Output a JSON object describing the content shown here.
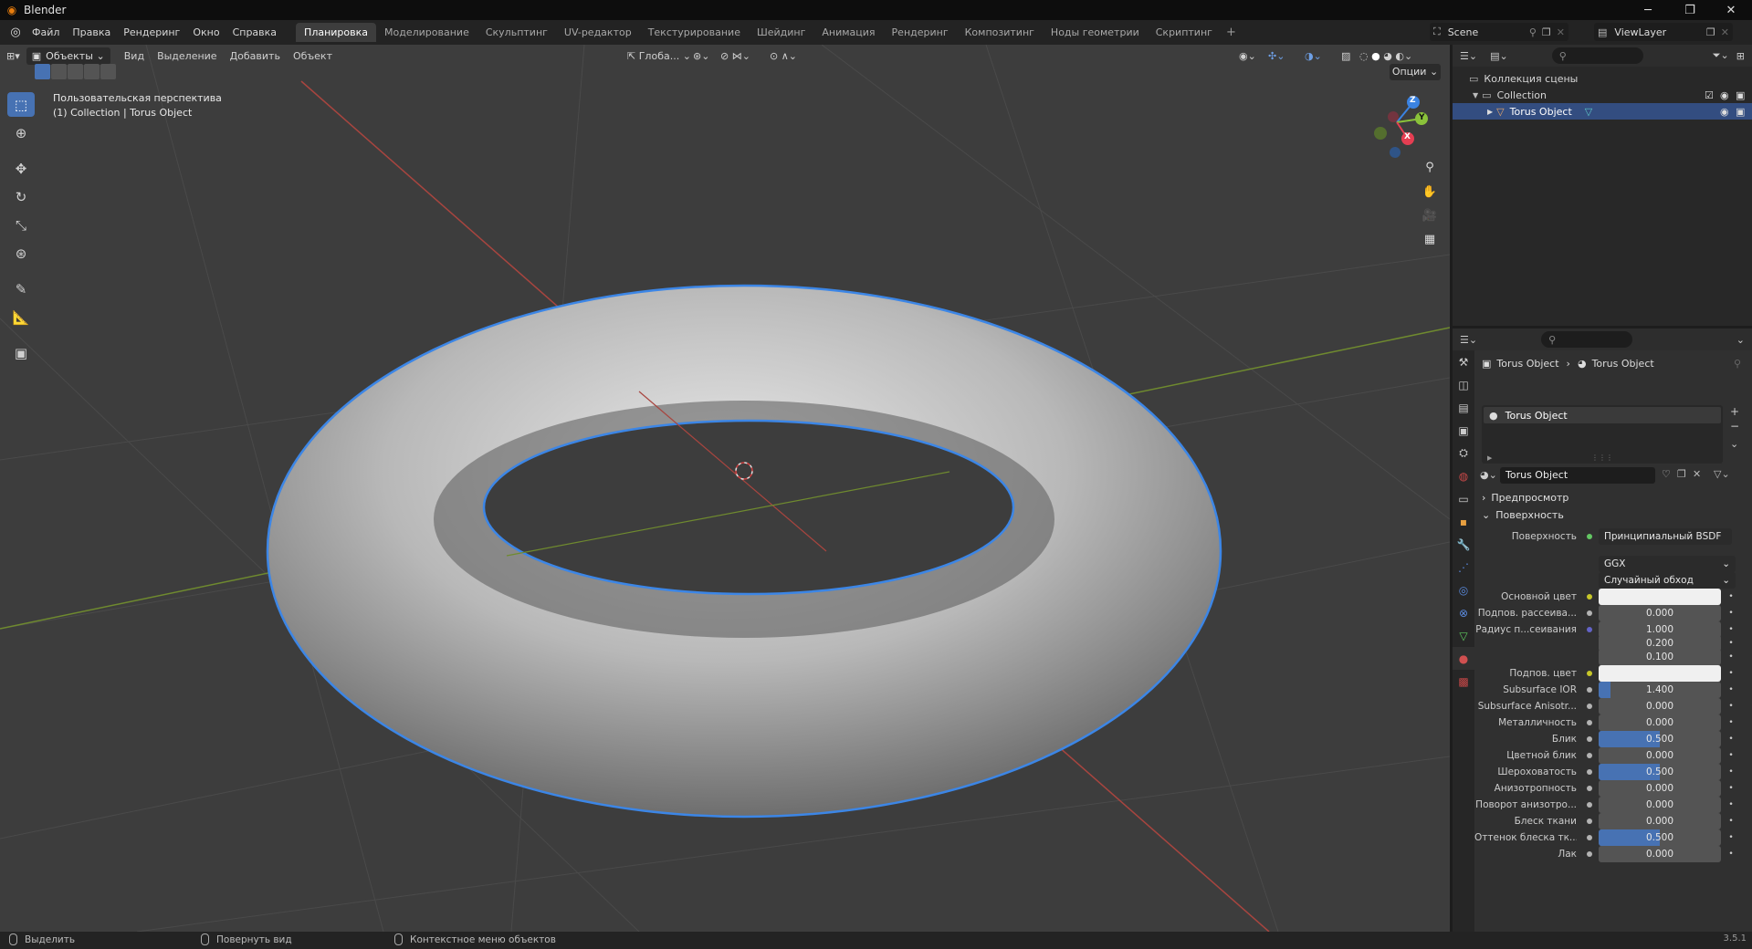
{
  "window": {
    "title": "Blender",
    "minimize_icon": "minimize-icon",
    "maximize_icon": "restore-icon",
    "close_icon": "close-icon"
  },
  "menu": [
    "Файл",
    "Правка",
    "Рендеринг",
    "Окно",
    "Справка"
  ],
  "workspaces": [
    {
      "label": "Планировка",
      "active": true
    },
    {
      "label": "Моделирование"
    },
    {
      "label": "Скульптинг"
    },
    {
      "label": "UV-редактор"
    },
    {
      "label": "Текстурирование"
    },
    {
      "label": "Шейдинг"
    },
    {
      "label": "Анимация"
    },
    {
      "label": "Рендеринг"
    },
    {
      "label": "Композитинг"
    },
    {
      "label": "Ноды геометрии"
    },
    {
      "label": "Скриптинг"
    }
  ],
  "workspace_add": "+",
  "scene": {
    "name": "Scene"
  },
  "view_layer": {
    "name": "ViewLayer"
  },
  "viewport": {
    "mode": "Объекты",
    "menus": [
      "Вид",
      "Выделение",
      "Добавить",
      "Объект"
    ],
    "orientation": "Глоба...",
    "options_label": "Опции",
    "overlay_line1": "Пользовательская перспектива",
    "overlay_line2": "(1) Collection | Torus Object",
    "gizmo_axes": {
      "x": "X",
      "y": "Y",
      "z": "Z"
    },
    "colors": {
      "grid_bg": "#3d3d3d",
      "x_axis": "#c8403e",
      "y_axis": "#7c9a2e",
      "selection": "#3c86e6"
    }
  },
  "outliner": {
    "root": "Коллекция сцены",
    "collection": "Collection",
    "object": "Torus Object"
  },
  "properties": {
    "breadcrumb_object": "Torus Object",
    "breadcrumb_material": "Torus Object",
    "slot_name": "Torus Object",
    "material_name": "Torus Object",
    "panel_preview": "Предпросмотр",
    "panel_surface": "Поверхность",
    "surface_label": "Поверхность",
    "surface_shader": "Принципиальный BSDF",
    "distribution": "GGX",
    "subsurface_method": "Случайный обход",
    "rows": [
      {
        "label": "Основной цвет",
        "type": "color",
        "dot": "yellow"
      },
      {
        "label": "Подпов. рассеива...",
        "value": "0.000",
        "dot": "gray"
      },
      {
        "label": "Радиус п...сеивания",
        "value": "1.000",
        "dot": "blue"
      },
      {
        "label": "",
        "value": "0.200",
        "dot": "none"
      },
      {
        "label": "",
        "value": "0.100",
        "dot": "none"
      },
      {
        "label": "Подпов. цвет",
        "type": "color",
        "dot": "yellow"
      },
      {
        "label": "Subsurface IOR",
        "value": "1.400",
        "fill": 0.1,
        "dot": "gray"
      },
      {
        "label": "Subsurface Anisotr...",
        "value": "0.000",
        "dot": "gray"
      },
      {
        "label": "Металличность",
        "value": "0.000",
        "dot": "gray"
      },
      {
        "label": "Блик",
        "value": "0.500",
        "fill": 0.5,
        "dot": "gray"
      },
      {
        "label": "Цветной блик",
        "value": "0.000",
        "dot": "gray"
      },
      {
        "label": "Шероховатость",
        "value": "0.500",
        "fill": 0.5,
        "dot": "gray"
      },
      {
        "label": "Анизотропность",
        "value": "0.000",
        "dot": "gray"
      },
      {
        "label": "Поворот анизотро...",
        "value": "0.000",
        "dot": "gray"
      },
      {
        "label": "Блеск ткани",
        "value": "0.000",
        "dot": "gray"
      },
      {
        "label": "Оттенок блеска тк...",
        "value": "0.500",
        "fill": 0.5,
        "dot": "gray"
      },
      {
        "label": "Лак",
        "value": "0.000",
        "dot": "gray"
      }
    ]
  },
  "statusbar": {
    "select": "Выделить",
    "rotate": "Повернуть вид",
    "context": "Контекстное меню объектов",
    "version": "3.5.1"
  }
}
